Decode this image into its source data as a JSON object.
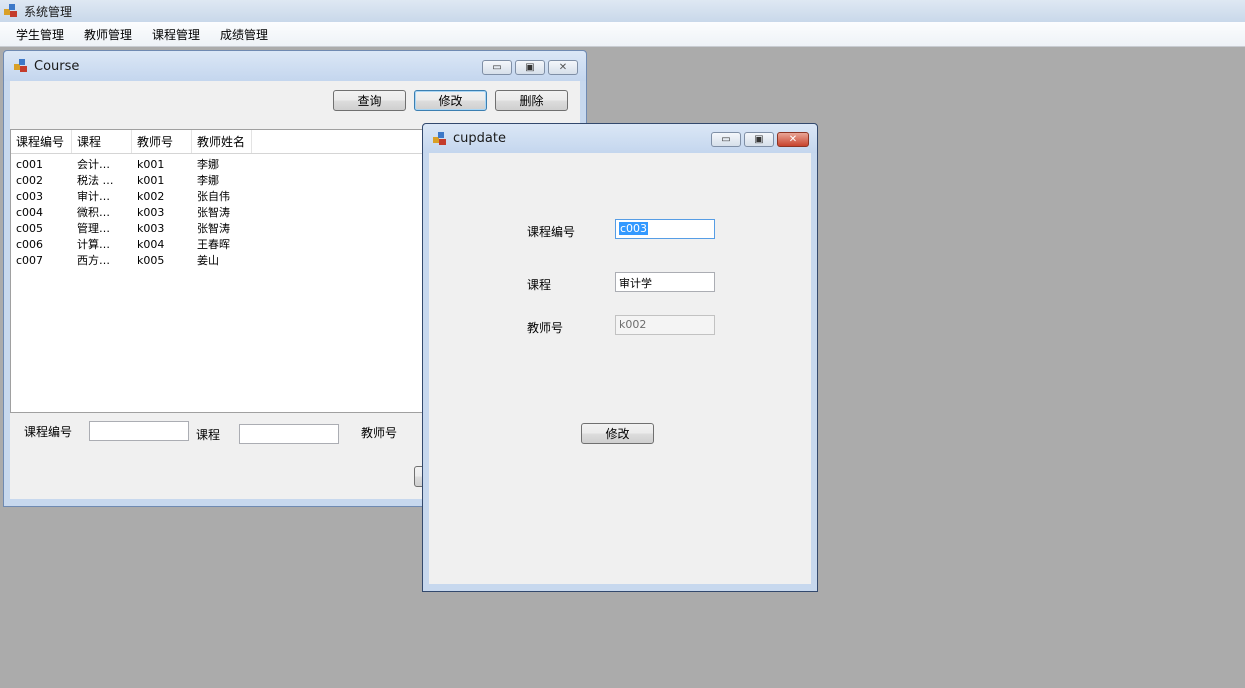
{
  "app": {
    "title": "系统管理"
  },
  "menu": [
    {
      "label": "学生管理"
    },
    {
      "label": "教师管理"
    },
    {
      "label": "课程管理"
    },
    {
      "label": "成绩管理"
    }
  ],
  "course_window": {
    "title": "Course",
    "buttons": {
      "query": "查询",
      "modify": "修改",
      "delete": "删除"
    },
    "columns": [
      "课程编号",
      "课程",
      "教师号",
      "教师姓名"
    ],
    "rows": [
      [
        "c001",
        "会计…",
        "k001",
        "李娜"
      ],
      [
        "c002",
        "税法 …",
        "k001",
        "李娜"
      ],
      [
        "c003",
        "审计…",
        "k002",
        "张自伟"
      ],
      [
        "c004",
        "微积…",
        "k003",
        "张智涛"
      ],
      [
        "c005",
        "管理…",
        "k003",
        "张智涛"
      ],
      [
        "c006",
        "计算…",
        "k004",
        "王春晖"
      ],
      [
        "c007",
        "西方…",
        "k005",
        "姜山"
      ]
    ],
    "form": {
      "course_id_label": "课程编号",
      "course_label": "课程",
      "teacher_id_label": "教师号"
    }
  },
  "cupdate_window": {
    "title": "cupdate",
    "course_id_label": "课程编号",
    "course_id_value": "c003",
    "course_label": "课程",
    "course_value": "审计学",
    "teacher_id_label": "教师号",
    "teacher_id_value": "k002",
    "modify_button": "修改"
  },
  "window_controls": {
    "minimize": "▭",
    "restore": "▣",
    "close": "✕"
  }
}
